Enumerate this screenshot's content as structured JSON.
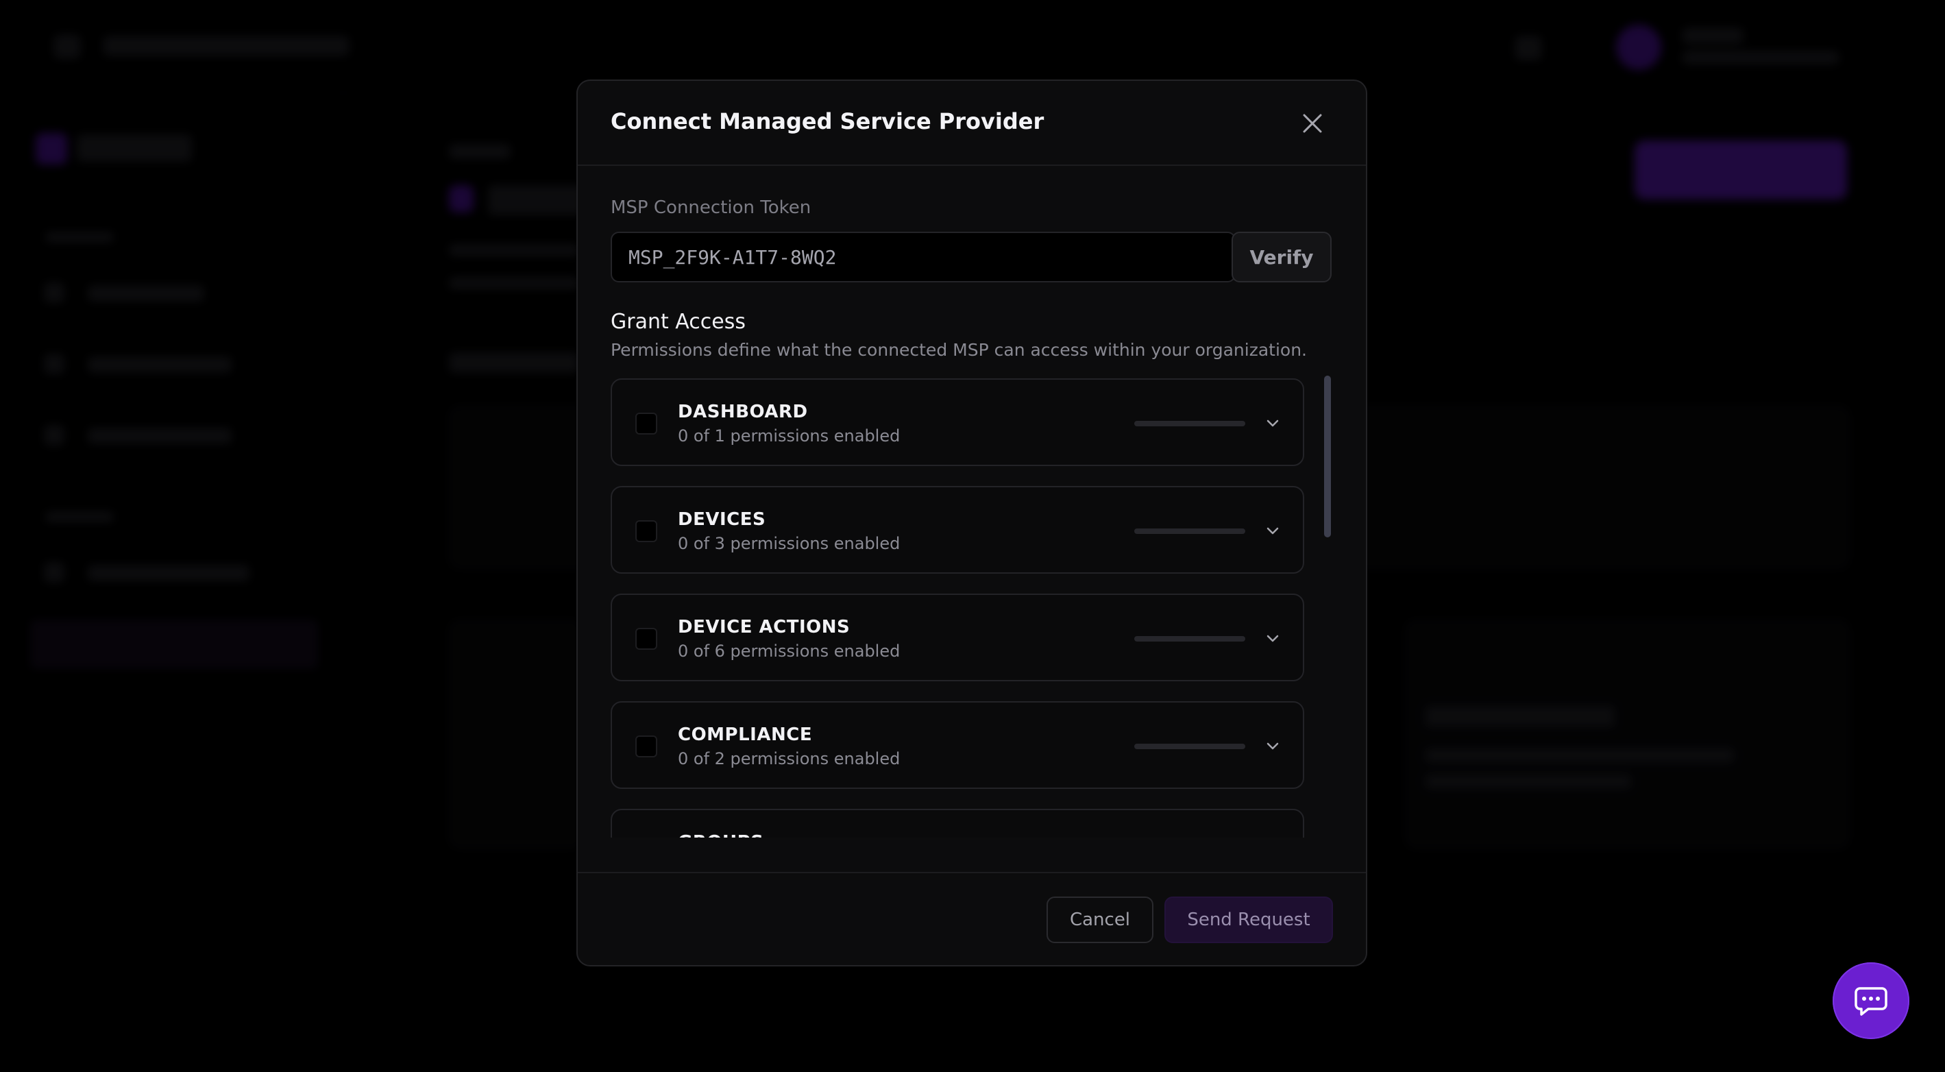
{
  "modal": {
    "title": "Connect Managed Service Provider",
    "token_label": "MSP Connection Token",
    "token_value": "MSP_2F9K-A1T7-8WQ2",
    "verify_label": "Verify",
    "grant_title": "Grant Access",
    "grant_description": "Permissions define what the connected MSP can access within your organization.",
    "permissions": [
      {
        "name": "DASHBOARD",
        "summary": "0 of 1 permissions enabled",
        "enabled": 0,
        "total": 1
      },
      {
        "name": "DEVICES",
        "summary": "0 of 3 permissions enabled",
        "enabled": 0,
        "total": 3
      },
      {
        "name": "DEVICE ACTIONS",
        "summary": "0 of 6 permissions enabled",
        "enabled": 0,
        "total": 6
      },
      {
        "name": "COMPLIANCE",
        "summary": "0 of 2 permissions enabled",
        "enabled": 0,
        "total": 2
      },
      {
        "name": "GROUPS",
        "summary": "",
        "enabled": 0,
        "total": 0
      }
    ],
    "cancel_label": "Cancel",
    "send_label": "Send Request"
  },
  "icons": {
    "close": "close-icon",
    "chevron": "chevron-down-icon",
    "chat": "chat-bubble-icon"
  },
  "colors": {
    "accent": "#6b1fd0",
    "modal_bg": "#0c0c0d",
    "backdrop": "#000000"
  }
}
